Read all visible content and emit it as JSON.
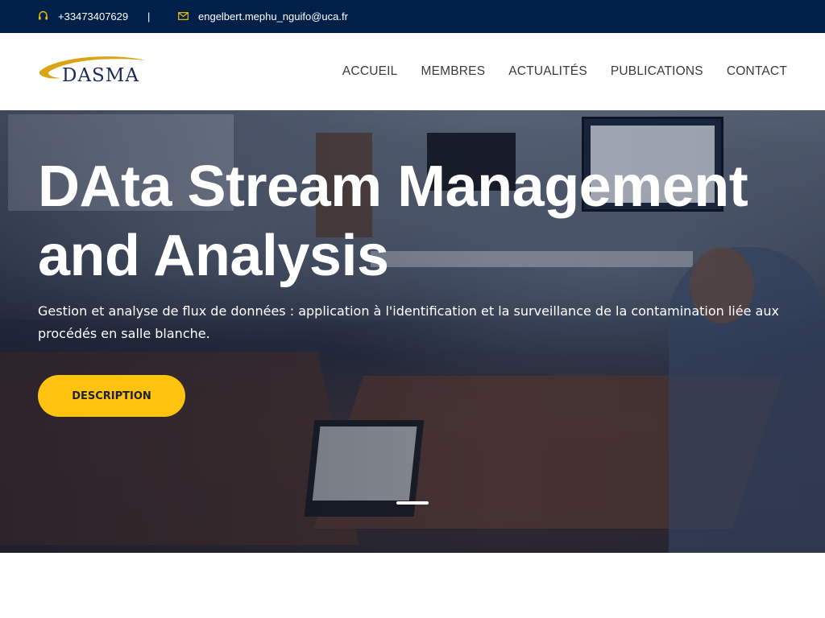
{
  "topbar": {
    "phone": "+33473407629",
    "separator": "|",
    "email": "engelbert.mephu_nguifo@uca.fr",
    "phone_icon": "headset-icon",
    "mail_icon": "envelope-icon",
    "accent": "#f2c200"
  },
  "header": {
    "logo_text": "DASMA",
    "nav": [
      "ACCUEIL",
      "MEMBRES",
      "ACTUALITÉS",
      "PUBLICATIONS",
      "CONTACT"
    ]
  },
  "hero": {
    "title": "DAta Stream Management and Analysis",
    "subtitle": "Gestion et analyse de flux de données : application à l'identification et la surveillance de la contamination liée aux procédés en salle blanche.",
    "button_label": "DESCRIPTION",
    "button_color": "#ffc20e",
    "slide_indicator_count": 1,
    "active_slide": 1
  },
  "colors": {
    "topbar_bg": "#00204a",
    "nav_text": "#3a3a3a"
  }
}
